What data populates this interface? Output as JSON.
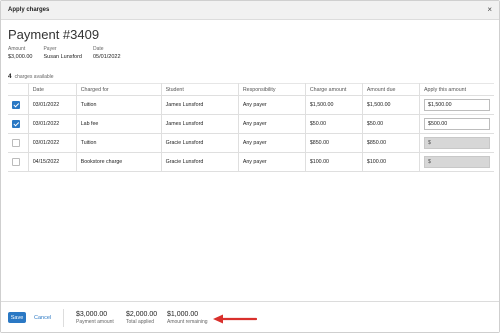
{
  "dialog": {
    "title": "Apply charges",
    "close_glyph": "×"
  },
  "payment": {
    "heading": "Payment #3409",
    "meta": [
      {
        "label": "Amount",
        "value": "$3,000.00"
      },
      {
        "label": "Payer",
        "value": "Susan Lunsford"
      },
      {
        "label": "Date",
        "value": "05/01/2022"
      }
    ]
  },
  "charges": {
    "count": "4",
    "count_label": "charges available",
    "columns": [
      "Date",
      "Charged for",
      "Student",
      "Responsibility",
      "Charge amount",
      "Amount due",
      "Apply this amount"
    ],
    "rows": [
      {
        "checked": true,
        "date": "03/01/2022",
        "charged_for": "Tuition",
        "student": "James Lunsford",
        "responsibility": "Any payer",
        "charge_amount": "$1,500.00",
        "amount_due": "$1,500.00",
        "apply": "$1,500.00",
        "apply_enabled": true
      },
      {
        "checked": true,
        "date": "03/01/2022",
        "charged_for": "Lab fee",
        "student": "James Lunsford",
        "responsibility": "Any payer",
        "charge_amount": "$50.00",
        "amount_due": "$50.00",
        "apply": "$500.00",
        "apply_enabled": true
      },
      {
        "checked": false,
        "date": "03/01/2022",
        "charged_for": "Tuition",
        "student": "Gracie Lunsford",
        "responsibility": "Any payer",
        "charge_amount": "$850.00",
        "amount_due": "$850.00",
        "apply": "$",
        "apply_enabled": false
      },
      {
        "checked": false,
        "date": "04/15/2022",
        "charged_for": "Bookstore charge",
        "student": "Gracie Lunsford",
        "responsibility": "Any payer",
        "charge_amount": "$100.00",
        "amount_due": "$100.00",
        "apply": "$",
        "apply_enabled": false
      }
    ]
  },
  "footer": {
    "save_label": "Save",
    "cancel_label": "Cancel",
    "totals": [
      {
        "value": "$3,000.00",
        "label": "Payment amount"
      },
      {
        "value": "$2,000.00",
        "label": "Total applied"
      },
      {
        "value": "$1,000.00",
        "label": "Amount remaining"
      }
    ]
  },
  "colors": {
    "accent": "#2a78c4",
    "arrow": "#d9302c"
  }
}
